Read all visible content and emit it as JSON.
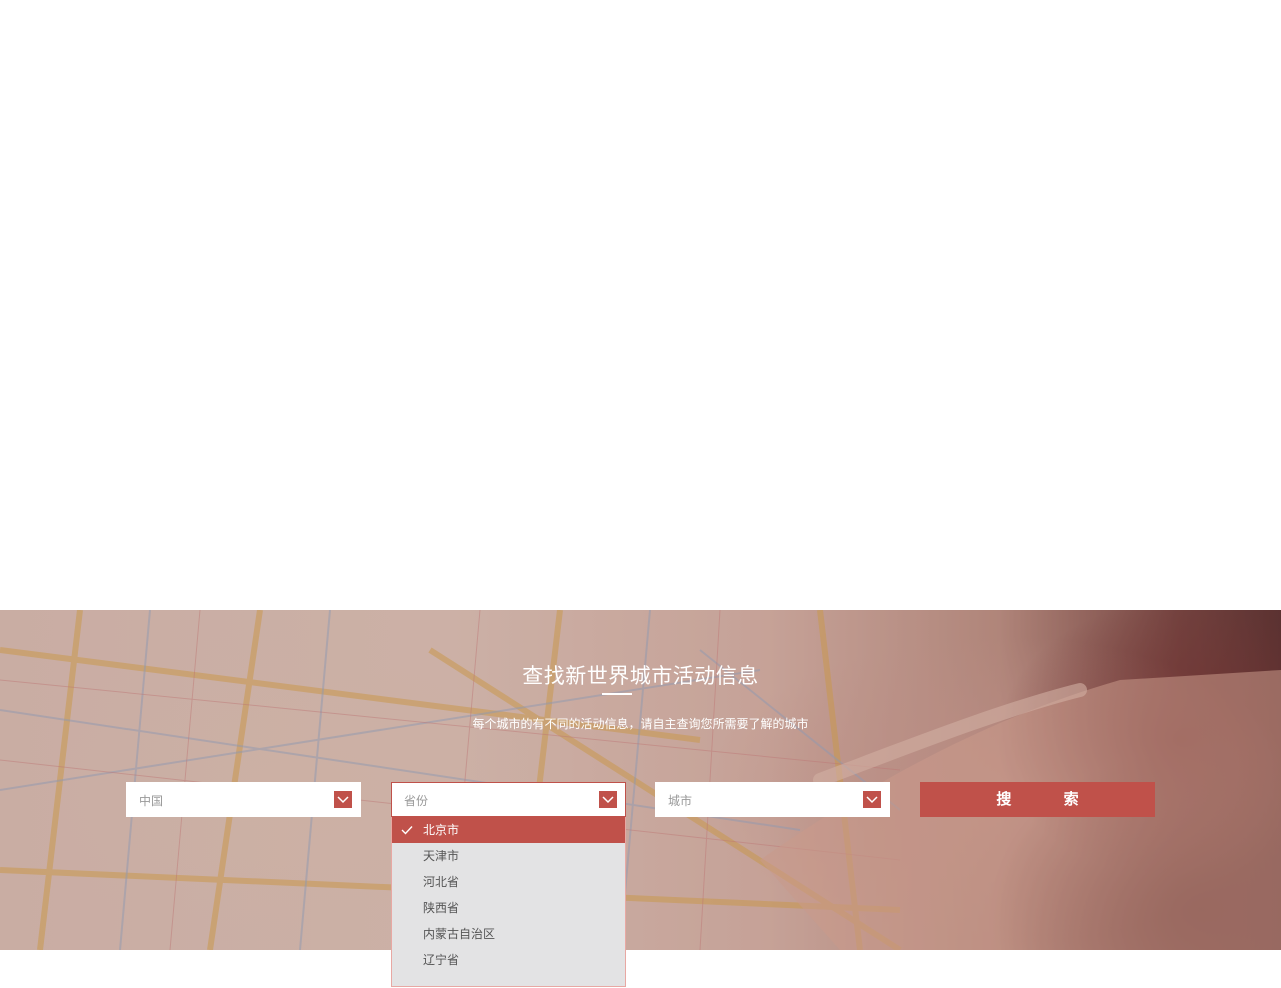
{
  "hero": {
    "title": "查找新世界城市活动信息",
    "subtitle": "每个城市的有不同的活动信息，请自主查询您所需要了解的城市"
  },
  "filters": {
    "country": {
      "value": "中国",
      "icon": "chevron-down-icon"
    },
    "province": {
      "value": "省份",
      "icon": "chevron-down-icon",
      "open": true
    },
    "city": {
      "value": "城市",
      "icon": "chevron-down-icon"
    },
    "search_label": "搜 索"
  },
  "province_options": [
    {
      "label": "北京市",
      "selected": true
    },
    {
      "label": "天津市",
      "selected": false
    },
    {
      "label": "河北省",
      "selected": false
    },
    {
      "label": "陕西省",
      "selected": false
    },
    {
      "label": "内蒙古自治区",
      "selected": false
    },
    {
      "label": "辽宁省",
      "selected": false
    }
  ],
  "colors": {
    "accent": "#c0514a",
    "dropdown_bg": "#e3e3e4",
    "text_muted": "#999999"
  }
}
